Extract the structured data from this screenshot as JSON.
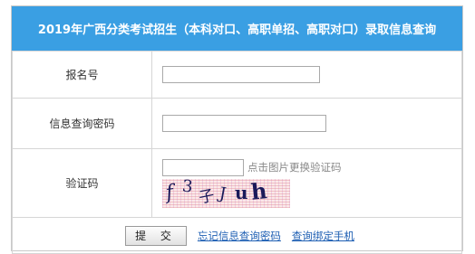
{
  "header": {
    "title": "2019年广西分类考试招生（本科对口、高职单招、高职对口）录取信息查询"
  },
  "form": {
    "registration_label": "报名号",
    "registration_value": "",
    "password_label": "信息查询密码",
    "password_value": "",
    "captcha_label": "验证码",
    "captcha_value": "",
    "captcha_hint": "点击图片更换验证码",
    "captcha_chars": [
      "f",
      "3",
      "子",
      "J",
      "u",
      "h"
    ]
  },
  "actions": {
    "submit_label": "提 交",
    "forgot_password_link": "忘记信息查询密码",
    "query_phone_link": "查询绑定手机"
  },
  "colors": {
    "header_bg": "#3a9fe3",
    "link": "#1e5fb3"
  }
}
